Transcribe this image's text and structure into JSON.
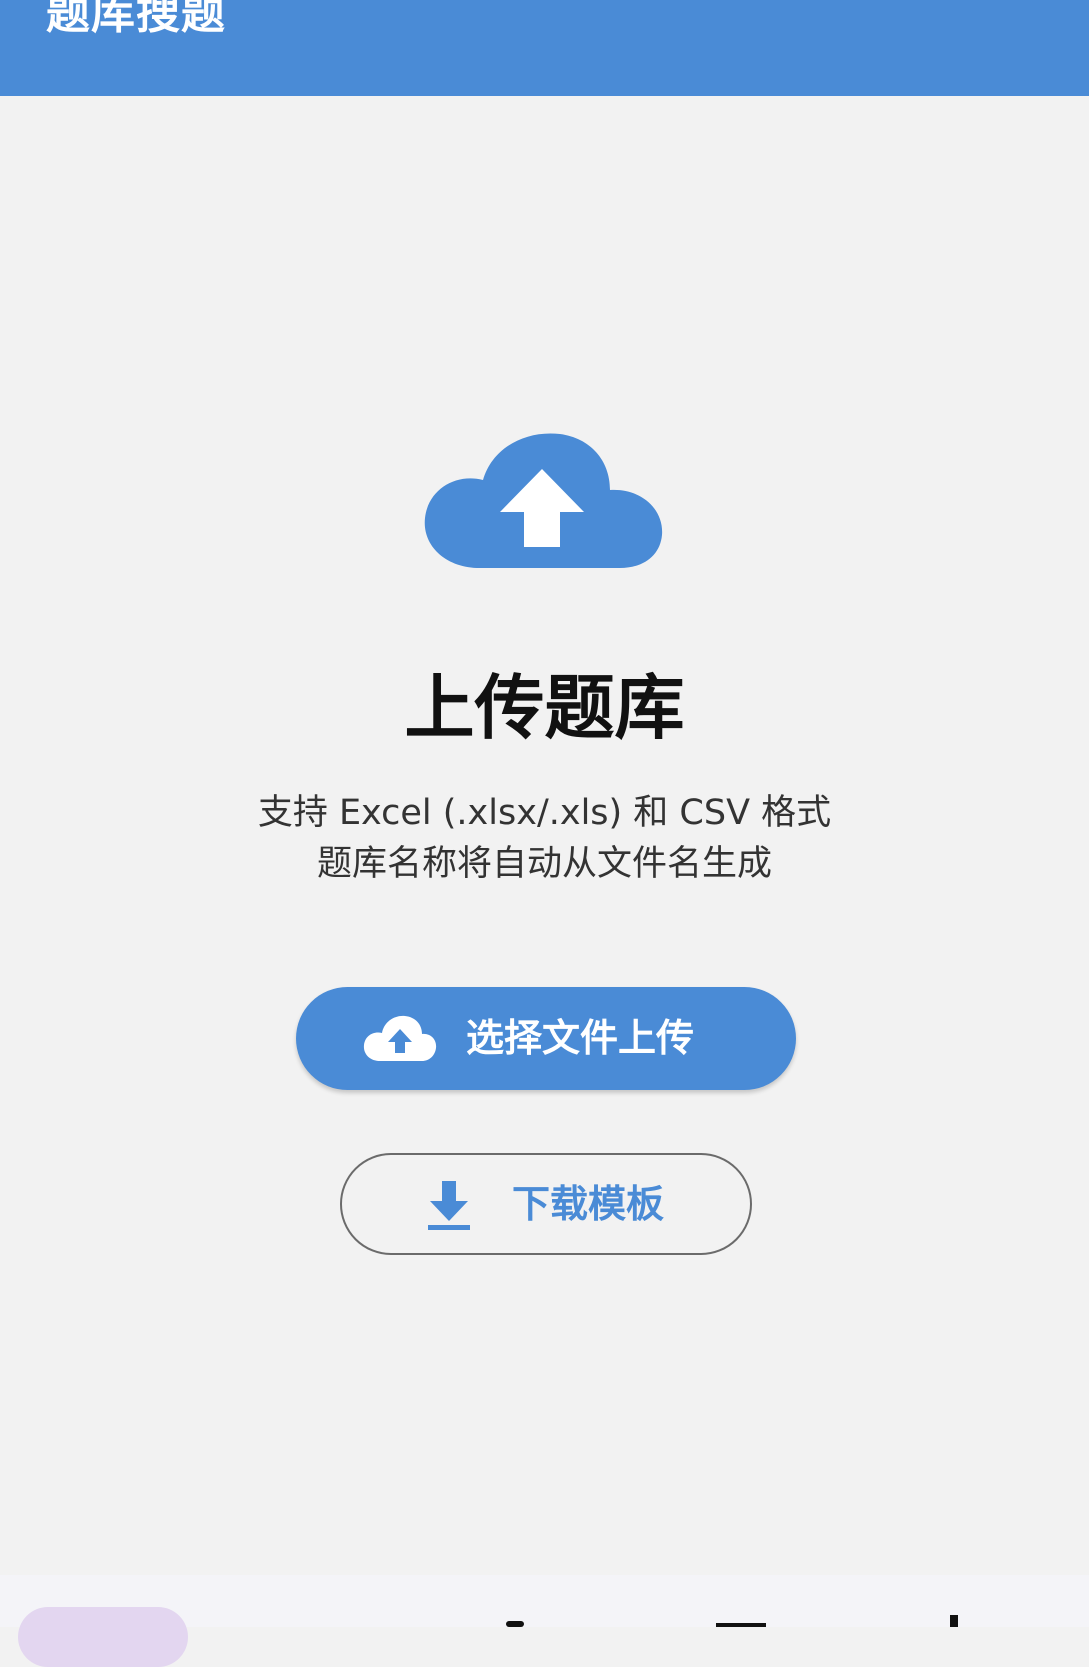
{
  "header": {
    "title": "题库搜题"
  },
  "main": {
    "hero_icon": "cloud-upload-icon",
    "title": "上传题库",
    "description_line1": "支持 Excel (.xlsx/.xls) 和 CSV 格式",
    "description_line2": "题库名称将自动从文件名生成"
  },
  "actions": {
    "upload_label": "选择文件上传",
    "upload_icon": "cloud-upload-icon",
    "download_label": "下载模板",
    "download_icon": "download-icon"
  },
  "colors": {
    "primary": "#4a8bd6",
    "background": "#f2f2f2",
    "title_text": "#111111",
    "body_text": "#333333",
    "nav_pill": "#e3d6f0"
  }
}
